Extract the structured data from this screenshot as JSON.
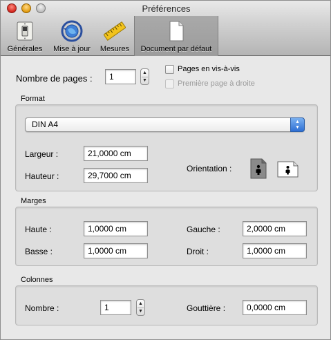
{
  "window": {
    "title": "Préférences"
  },
  "toolbar": {
    "items": [
      {
        "label": "Générales",
        "icon": "light-switch-icon"
      },
      {
        "label": "Mise à jour",
        "icon": "update-globe-icon"
      },
      {
        "label": "Mesures",
        "icon": "ruler-icon"
      },
      {
        "label": "Document par défaut",
        "icon": "document-icon",
        "selected": true
      }
    ]
  },
  "pages": {
    "label": "Nombre de pages :",
    "value": "1",
    "facing_label": "Pages en vis-à-vis",
    "facing_checked": false,
    "first_right_label": "Première page à droite",
    "first_right_checked": false,
    "first_right_enabled": false
  },
  "format": {
    "title": "Format",
    "paper": "DIN A4",
    "width_label": "Largeur :",
    "width_value": "21,0000 cm",
    "height_label": "Hauteur :",
    "height_value": "29,7000 cm",
    "orientation_label": "Orientation :",
    "orientation_selected": "portrait"
  },
  "margins": {
    "title": "Marges",
    "top_label": "Haute :",
    "top_value": "1,0000 cm",
    "bottom_label": "Basse :",
    "bottom_value": "1,0000 cm",
    "left_label": "Gauche :",
    "left_value": "2,0000 cm",
    "right_label": "Droit :",
    "right_value": "1,0000 cm"
  },
  "columns": {
    "title": "Colonnes",
    "count_label": "Nombre :",
    "count_value": "1",
    "gutter_label": "Gouttière :",
    "gutter_value": "0,0000 cm"
  },
  "colors": {
    "accent": "#2e6fd4",
    "close": "#d3241b",
    "minimize": "#e29b0d"
  }
}
